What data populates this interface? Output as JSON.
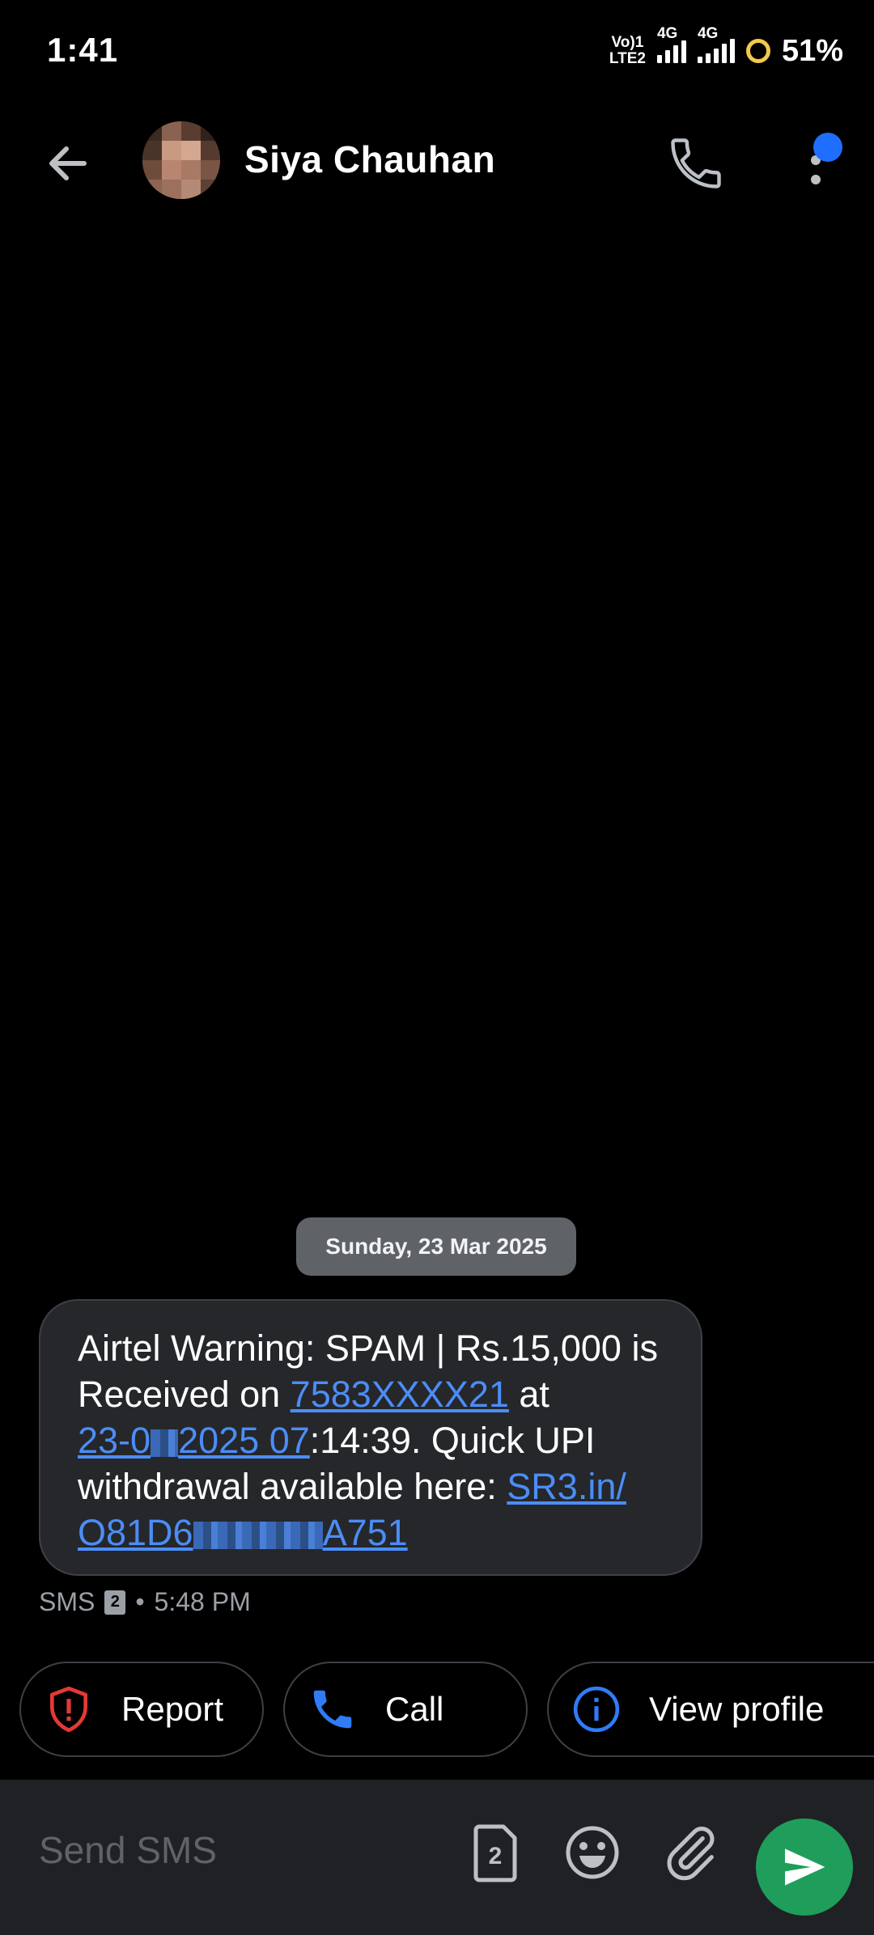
{
  "status_bar": {
    "time": "1:41",
    "network_sim1": "Vo) 1\nLTE2",
    "network_4g_a": "4G",
    "network_4g_b": "4G",
    "battery": "51%"
  },
  "header": {
    "contact_name": "Siya Chauhan",
    "icons": [
      "back-arrow-icon",
      "phone-icon",
      "more-vert-icon"
    ]
  },
  "conversation": {
    "date_separator": "Sunday, 23 Mar 2025",
    "message": {
      "text_1": "Airtel Warning: SPAM | Rs.15,000 is Received on ",
      "link_phone": "7583XXXX21",
      "text_2": " at ",
      "link_date_a": "23-0",
      "link_date_b": "2025 07",
      "text_3": ":14:39. Quick UPI withdrawal available here: ",
      "link_url_a": "SR3.in/",
      "link_url_b": "O81D6",
      "link_url_c": "A751"
    },
    "meta": {
      "type": "SMS",
      "sim": "2",
      "sep": "•",
      "time": "5:48 PM"
    }
  },
  "actions": {
    "report_label": "Report",
    "call_label": "Call",
    "view_profile_label": "View profile"
  },
  "composer": {
    "placeholder": "Send SMS",
    "sim_badge": "2"
  },
  "colors": {
    "link": "#4c8df6",
    "send_button": "#1e9e5a",
    "report_icon": "#e53935",
    "accent_blue": "#1e6fff"
  }
}
